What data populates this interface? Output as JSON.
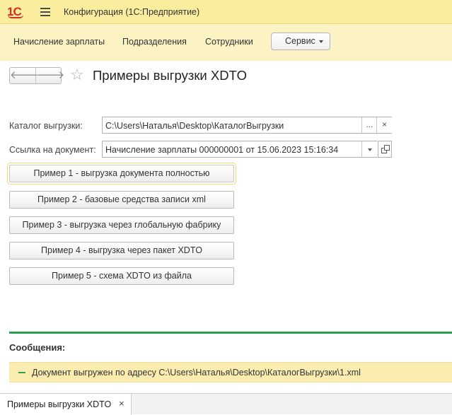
{
  "titlebar": {
    "logo": "1С",
    "app_title": "Конфигурация  (1С:Предприятие)"
  },
  "sections": {
    "items": [
      {
        "label": "Начисление зарплаты"
      },
      {
        "label": "Подразделения"
      },
      {
        "label": "Сотрудники"
      }
    ],
    "service_label": "Сервис"
  },
  "form": {
    "back_glyph": "🡐",
    "forward_glyph": "🡒",
    "title": "Примеры выгрузки XDTO",
    "catalog": {
      "label": "Каталог выгрузки:",
      "value": "C:\\Users\\Наталья\\Desktop\\КаталогВыгрузки",
      "choose_glyph": "...",
      "clear_glyph": "×"
    },
    "document": {
      "label": "Ссылка на документ:",
      "value": "Начисление зарплаты 000000001 от 15.06.2023 15:16:34"
    },
    "buttons": [
      {
        "label": "Пример 1 - выгрузка документа полностью"
      },
      {
        "label": "Пример 2 - базовые средства записи xml"
      },
      {
        "label": "Пример 3 - выгрузка через глобальную фабрику"
      },
      {
        "label": "Пример 4 - выгрузка через пакет XDTO"
      },
      {
        "label": "Пример 5 - схема XDTO из файла"
      }
    ]
  },
  "messages": {
    "title": "Сообщения:",
    "items": [
      {
        "text": "Документ выгружен по адресу C:\\Users\\Наталья\\Desktop\\КаталогВыгрузки\\1.xml"
      }
    ]
  },
  "tabs": [
    {
      "label": "Примеры выгрузки XDTO",
      "close_glyph": "×"
    }
  ],
  "colors": {
    "titlebar_bg": "#fbed9e",
    "sections_bg": "#fbf3c4",
    "logo": "#d52f26",
    "message_line": "#26a04a",
    "message_bg": "#faedaf"
  }
}
